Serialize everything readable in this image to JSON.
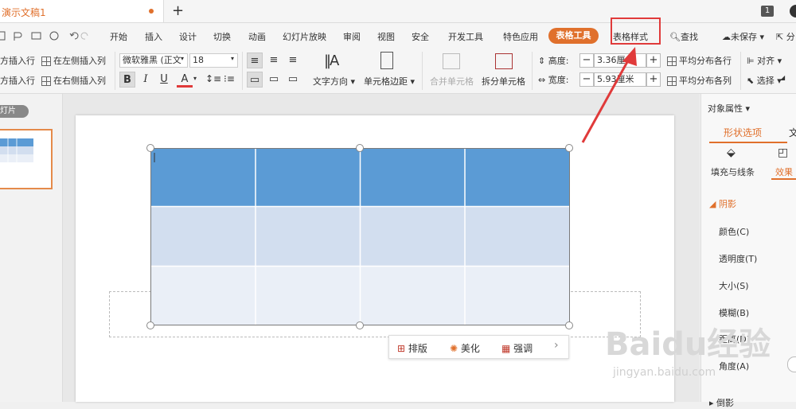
{
  "titlebar": {
    "doc_tab": "演示文稿1",
    "new_tab": "+",
    "badge": "1"
  },
  "menu": {
    "items": [
      "开始",
      "插入",
      "设计",
      "切换",
      "动画",
      "幻灯片放映",
      "审阅",
      "视图",
      "安全",
      "开发工具",
      "特色应用"
    ],
    "active": "表格工具",
    "table_style": "表格样式",
    "search": "查找",
    "unsaved": "未保存",
    "share": "分"
  },
  "toolbar": {
    "insert_above": "方插入行",
    "insert_below": "方插入行",
    "insert_left": "在左侧插入列",
    "insert_right": "在右侧插入列",
    "font_name": "微软雅黑 (正文",
    "font_size": "18",
    "bold": "B",
    "italic": "I",
    "underline": "U",
    "font_color": "A",
    "text_direction": "文字方向",
    "cell_margin": "单元格边距",
    "merge_cells": "合并单元格",
    "split_cells": "拆分单元格",
    "height_label": "高度:",
    "height_value": "3.36厘",
    "width_label": "宽度:",
    "width_value": "5.93厘米",
    "distribute_rows": "平均分布各行",
    "distribute_cols": "平均分布各列",
    "align": "对齐",
    "select": "选择",
    "minus": "−",
    "plus": "+"
  },
  "left_panel": {
    "slides_label": "幻灯片"
  },
  "float_bar": {
    "layout": "排版",
    "beautify": "美化",
    "emphasize": "强调",
    "more": "›"
  },
  "right_panel": {
    "object_props": "对象属性",
    "tab_shape": "形状选项",
    "tab_text": "文",
    "fill_line": "填充与线条",
    "effects": "效果",
    "shadow": "阴影",
    "color": "颜色(C)",
    "transparency": "透明度(T)",
    "size": "大小(S)",
    "blur": "模糊(B)",
    "distance": "距离(D)",
    "angle": "角度(A)",
    "reflection": "倒影"
  },
  "watermark": {
    "brand": "Baidu经验",
    "url": "jingyan.baidu.com"
  },
  "colors": {
    "accent": "#e0702c",
    "table_header": "#5b9bd5",
    "table_row1": "#d2deef",
    "table_row2": "#eaeff7",
    "highlight": "#e03a3a"
  }
}
